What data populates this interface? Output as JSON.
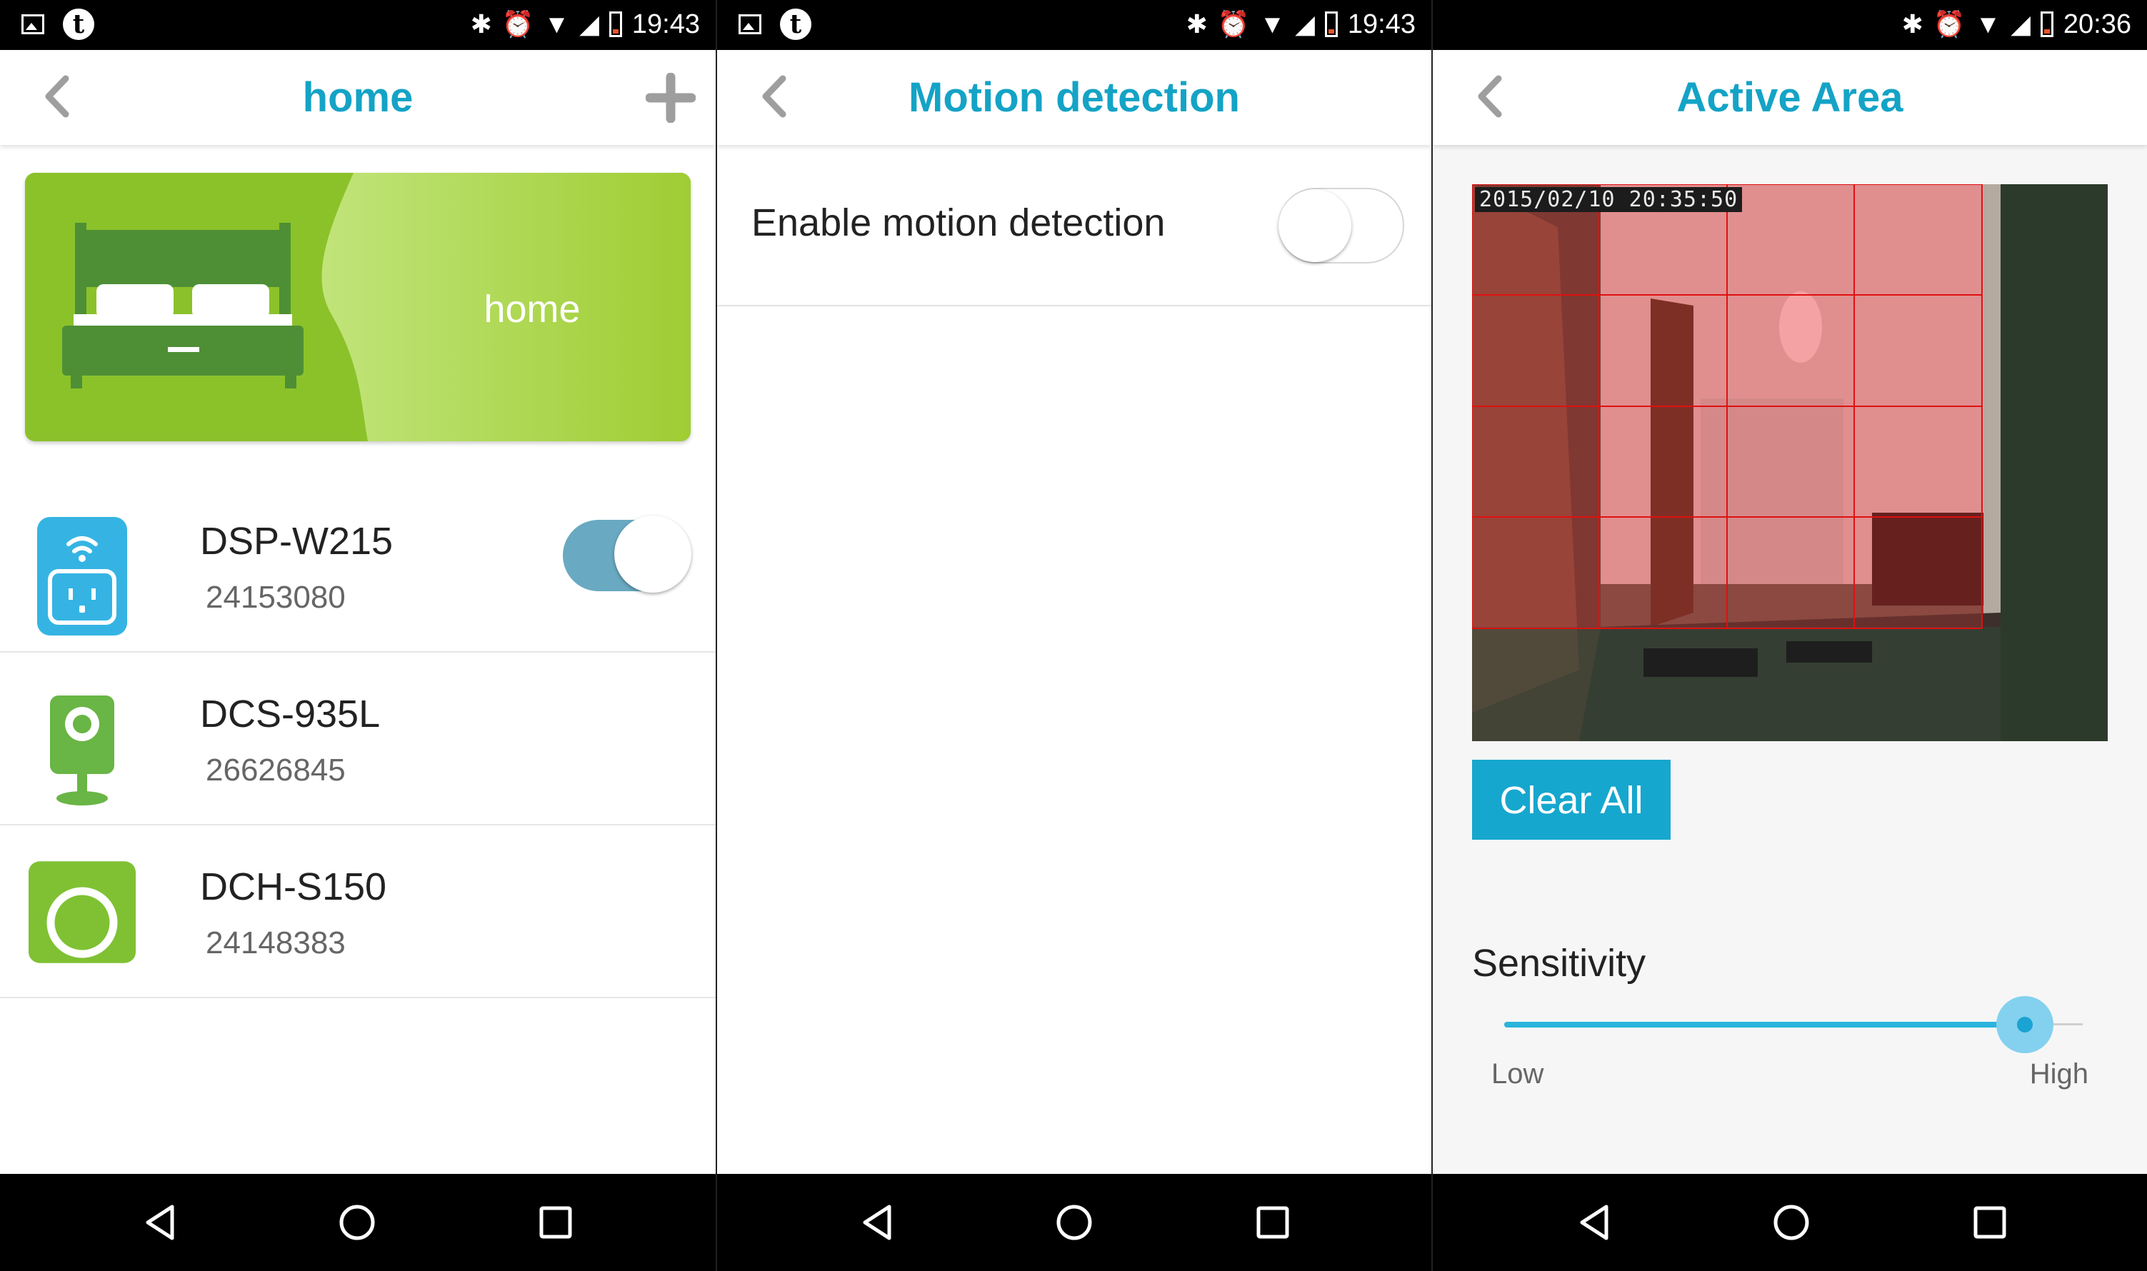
{
  "status_bars": [
    {
      "time": "19:43"
    },
    {
      "time": "19:43"
    },
    {
      "time": "20:36"
    }
  ],
  "home_screen": {
    "title": "home",
    "card_label": "home",
    "devices": [
      {
        "name": "DSP-W215",
        "id": "24153080",
        "icon": "smart-plug-icon",
        "toggle_on": true
      },
      {
        "name": "DCS-935L",
        "id": "26626845",
        "icon": "camera-icon"
      },
      {
        "name": "DCH-S150",
        "id": "24148383",
        "icon": "motion-sensor-icon"
      }
    ]
  },
  "motion_screen": {
    "title": "Motion detection",
    "enable_label": "Enable motion detection",
    "enabled": false
  },
  "active_area_screen": {
    "title": "Active Area",
    "camera_timestamp": "2015/02/10 20:35:50",
    "clear_button": "Clear All",
    "sensitivity_label": "Sensitivity",
    "sensitivity_low": "Low",
    "sensitivity_high": "High",
    "sensitivity_level": 0.9
  },
  "colors": {
    "accent": "#14a3c6",
    "card_green": "#9ccd2e",
    "toggle_on": "#69a9c1",
    "grid_line": "#e01010"
  }
}
